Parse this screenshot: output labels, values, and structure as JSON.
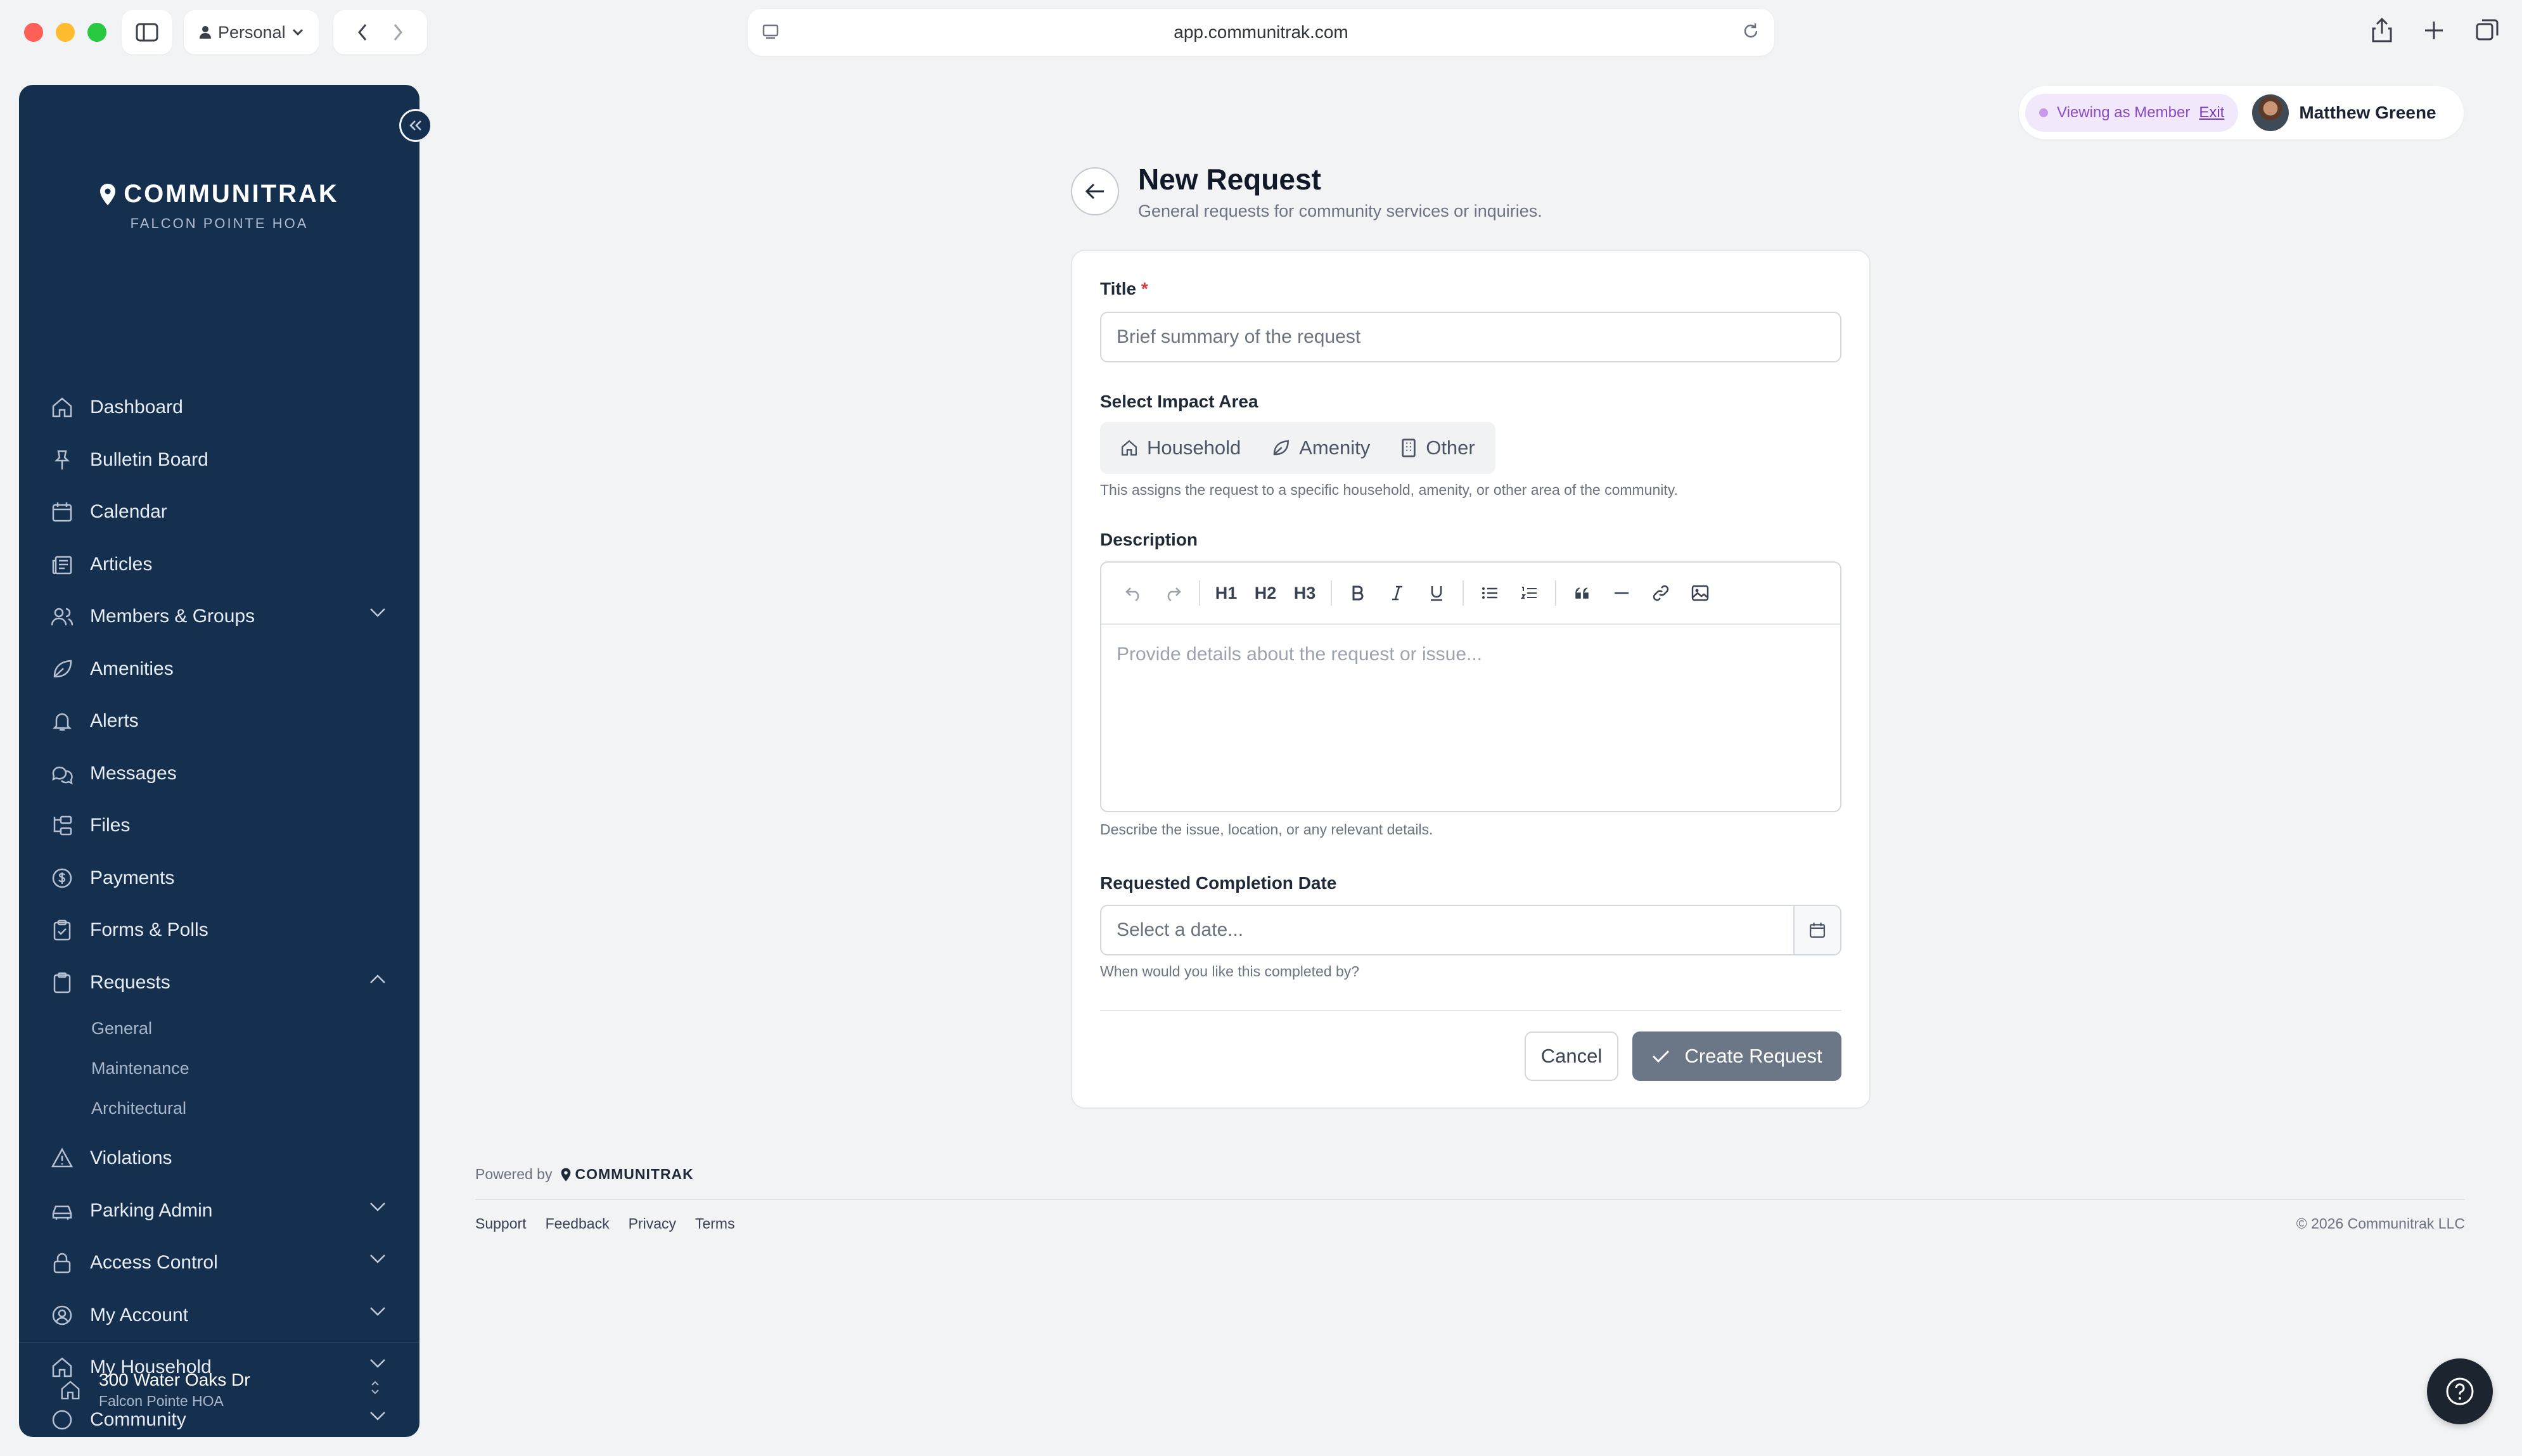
{
  "browser": {
    "profile": "Personal",
    "url": "app.communitrak.com"
  },
  "sidebar": {
    "brand": "COMMUNITRAK",
    "community": "FALCON POINTE HOA",
    "items": [
      {
        "label": "Dashboard"
      },
      {
        "label": "Bulletin Board"
      },
      {
        "label": "Calendar"
      },
      {
        "label": "Articles"
      },
      {
        "label": "Members & Groups"
      },
      {
        "label": "Amenities"
      },
      {
        "label": "Alerts"
      },
      {
        "label": "Messages"
      },
      {
        "label": "Files"
      },
      {
        "label": "Payments"
      },
      {
        "label": "Forms & Polls"
      },
      {
        "label": "Requests"
      },
      {
        "label": "Violations"
      },
      {
        "label": "Parking Admin"
      },
      {
        "label": "Access Control"
      },
      {
        "label": "My Account"
      },
      {
        "label": "My Household"
      },
      {
        "label": "Community"
      }
    ],
    "request_subitems": [
      {
        "label": "General"
      },
      {
        "label": "Maintenance"
      },
      {
        "label": "Architectural"
      }
    ],
    "footer": {
      "address": "300 Water Oaks Dr",
      "community": "Falcon Pointe HOA"
    }
  },
  "user_bar": {
    "viewing_label": "Viewing as Member",
    "exit_label": "Exit",
    "user_name": "Matthew Greene"
  },
  "page": {
    "title": "New Request",
    "subtitle": "General requests for community services or inquiries."
  },
  "form": {
    "title_label": "Title",
    "required_mark": "*",
    "title_placeholder": "Brief summary of the request",
    "impact_label": "Select Impact Area",
    "impact_options": [
      {
        "label": "Household"
      },
      {
        "label": "Amenity"
      },
      {
        "label": "Other"
      }
    ],
    "impact_help": "This assigns the request to a specific household, amenity, or other area of the community.",
    "description_label": "Description",
    "toolbar": {
      "h1": "H1",
      "h2": "H2",
      "h3": "H3"
    },
    "description_placeholder": "Provide details about the request or issue...",
    "description_help": "Describe the issue, location, or any relevant details.",
    "date_label": "Requested Completion Date",
    "date_placeholder": "Select a date...",
    "date_help": "When would you like this completed by?",
    "cancel_label": "Cancel",
    "create_label": "Create Request"
  },
  "footer": {
    "powered_by": "Powered by",
    "brand": "COMMUNITRAK",
    "links": [
      {
        "label": "Support"
      },
      {
        "label": "Feedback"
      },
      {
        "label": "Privacy"
      },
      {
        "label": "Terms"
      }
    ],
    "copyright": "© 2026 Communitrak LLC"
  },
  "colors": {
    "sidebar_bg": "#15304f",
    "primary_button": "#6b7687",
    "accent_purple": "#8a4bc4",
    "required_red": "#e23b3b"
  }
}
